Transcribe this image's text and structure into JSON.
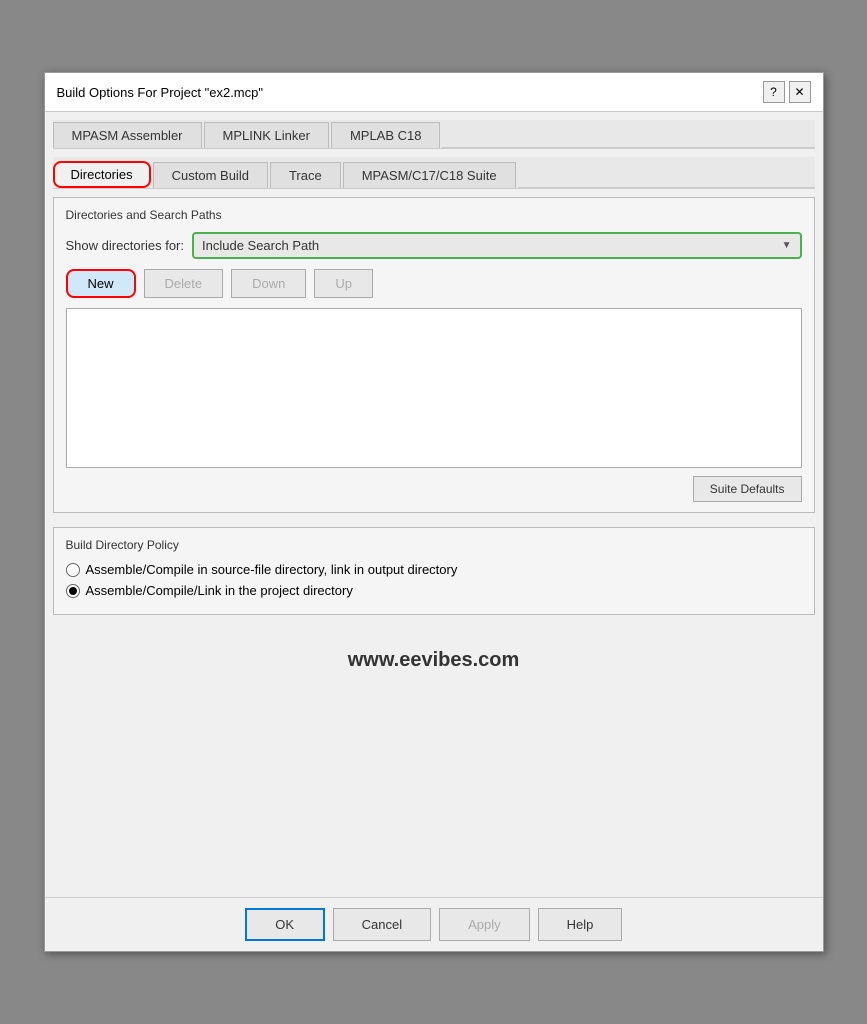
{
  "title": "Build Options For Project \"ex2.mcp\"",
  "help_icon": "?",
  "close_icon": "✕",
  "tabs_row1": [
    {
      "label": "MPASM Assembler"
    },
    {
      "label": "MPLINK Linker"
    },
    {
      "label": "MPLAB C18"
    }
  ],
  "tabs_row2": [
    {
      "label": "Directories",
      "active": true,
      "circled": true
    },
    {
      "label": "Custom Build"
    },
    {
      "label": "Trace"
    },
    {
      "label": "MPASM/C17/C18 Suite"
    }
  ],
  "directories_section": {
    "title": "Directories and Search Paths",
    "show_label": "Show directories for:",
    "dropdown_value": "Include Search Path",
    "buttons": {
      "new": "New",
      "delete": "Delete",
      "down": "Down",
      "up": "Up"
    },
    "suite_defaults": "Suite Defaults"
  },
  "policy_section": {
    "title": "Build Directory Policy",
    "options": [
      {
        "label": "Assemble/Compile in source-file directory, link in output directory",
        "selected": false
      },
      {
        "label": "Assemble/Compile/Link in the project directory",
        "selected": true
      }
    ]
  },
  "watermark": "www.eevibes.com",
  "bottom_buttons": {
    "ok": "OK",
    "cancel": "Cancel",
    "apply": "Apply",
    "help": "Help"
  }
}
